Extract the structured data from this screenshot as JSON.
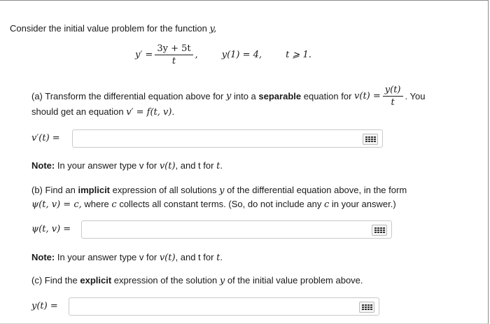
{
  "intro": {
    "text": "Consider the initial value problem for the function",
    "var": "y,"
  },
  "ivp": {
    "lhs": "y′ =",
    "numerator": "3y + 5t",
    "denominator": "t",
    "comma": ",",
    "initial": "y(1) = 4,",
    "domain": "t ⩾ 1."
  },
  "part_a": {
    "prefix": "(a) Transform the differential equation above for",
    "var_y": "y",
    "mid": "into a",
    "bold": "separable",
    "after_bold": "equation for",
    "v_def": "v(t) =",
    "frac_num": "y(t)",
    "frac_den": "t",
    "suffix": ". You",
    "line2_text": "should get an equation",
    "line2_math": "v′ = f(t, v)",
    "line2_end": ".",
    "input_label": "v′(t) =",
    "note_bold": "Note:",
    "note_text": "In your answer type v for",
    "note_math1": "v(t)",
    "note_text2": ", and t for",
    "note_math2": "t",
    "note_end": "."
  },
  "part_b": {
    "prefix": "(b) Find an",
    "bold": "implicit",
    "text1": "expression of all solutions",
    "var_y": "y",
    "text2": "of the differential equation above, in the form",
    "line2_math": "ψ(t, v) = c,",
    "line2_text1": "where",
    "var_c": "c",
    "line2_text2": "collects all constant terms. (So, do not include any",
    "var_c2": "c",
    "line2_text3": "in your answer.)",
    "input_label": "ψ(t, v) =",
    "note_bold": "Note:",
    "note_text": "In your answer type v for",
    "note_math1": "v(t)",
    "note_text2": ", and t for",
    "note_math2": "t",
    "note_end": "."
  },
  "part_c": {
    "prefix": "(c) Find the",
    "bold": "explicit",
    "text1": "expression of the solution",
    "var_y": "y",
    "text2": "of the initial value problem above.",
    "input_label": "y(t) ="
  },
  "icons": {
    "keyboard": "keyboard-icon"
  }
}
